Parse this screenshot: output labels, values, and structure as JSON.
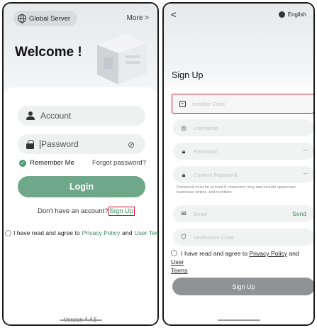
{
  "login": {
    "server_label": "Global Server",
    "more_label": "More >",
    "welcome": "Welcome !",
    "account_placeholder": "Account",
    "password_placeholder": "Password",
    "remember_label": "Remember Me",
    "forgot_label": "Forgot password?",
    "login_button": "Login",
    "no_account_text": "Don't have an account?",
    "signup_link": "Sign Up",
    "agree_prefix": "I have read and agree to",
    "privacy_policy": "Privacy Policy",
    "and_text": "and",
    "user_terms": "User Terms",
    "version": "Version 4.4.5"
  },
  "signup": {
    "back_label": "<",
    "language_label": "English",
    "title": "Sign Up",
    "fields": {
      "installer_code": "Installer Code",
      "username": "Username",
      "password": "Password",
      "confirm_password": "Confirm Password",
      "email": "Email",
      "verification_code": "Verification Code"
    },
    "send_label": "Send",
    "password_hint": "Password must be at least 8 characters long and include uppercase, lowercase letters, and numbers.",
    "agree_prefix": "I have read and agree to",
    "privacy_policy": "Privacy Policy",
    "and_text": "and",
    "user_terms_1": "User",
    "user_terms_2": "Terms",
    "signup_button": "Sign Up"
  },
  "colors": {
    "brand_green": "#6fa889",
    "link_green": "#3a8a5e",
    "highlight_red": "#d0152a",
    "disabled_gray": "#909395"
  }
}
